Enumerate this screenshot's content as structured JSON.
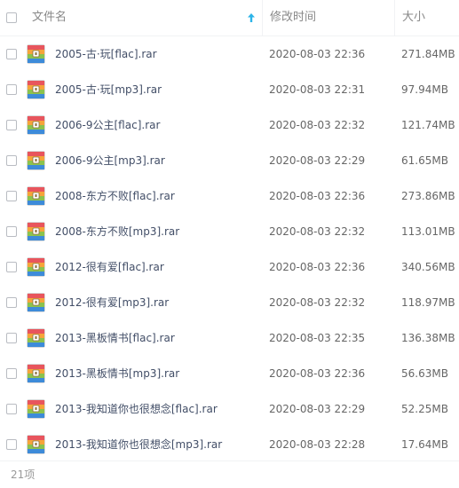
{
  "header": {
    "name_label": "文件名",
    "time_label": "修改时间",
    "size_label": "大小",
    "sort_direction": "ascending"
  },
  "colors": {
    "sort_arrow": "#2cb4e8",
    "icon_red": "#e8555d",
    "icon_orange": "#f6a43a",
    "icon_green": "#8cc34d",
    "icon_blue": "#3d8bd9"
  },
  "files": [
    {
      "name": "2005-古·玩[flac].rar",
      "time": "2020-08-03 22:36",
      "size": "271.84MB",
      "icon": "archive-rar-icon"
    },
    {
      "name": "2005-古·玩[mp3].rar",
      "time": "2020-08-03 22:31",
      "size": "97.94MB",
      "icon": "archive-rar-icon"
    },
    {
      "name": "2006-9公主[flac].rar",
      "time": "2020-08-03 22:32",
      "size": "121.74MB",
      "icon": "archive-rar-icon"
    },
    {
      "name": "2006-9公主[mp3].rar",
      "time": "2020-08-03 22:29",
      "size": "61.65MB",
      "icon": "archive-rar-icon"
    },
    {
      "name": "2008-东方不败[flac].rar",
      "time": "2020-08-03 22:36",
      "size": "273.86MB",
      "icon": "archive-rar-icon"
    },
    {
      "name": "2008-东方不败[mp3].rar",
      "time": "2020-08-03 22:32",
      "size": "113.01MB",
      "icon": "archive-rar-icon"
    },
    {
      "name": "2012-很有爱[flac].rar",
      "time": "2020-08-03 22:36",
      "size": "340.56MB",
      "icon": "archive-rar-icon"
    },
    {
      "name": "2012-很有爱[mp3].rar",
      "time": "2020-08-03 22:32",
      "size": "118.97MB",
      "icon": "archive-rar-icon"
    },
    {
      "name": "2013-黑板情书[flac].rar",
      "time": "2020-08-03 22:35",
      "size": "136.38MB",
      "icon": "archive-rar-icon"
    },
    {
      "name": "2013-黑板情书[mp3].rar",
      "time": "2020-08-03 22:36",
      "size": "56.63MB",
      "icon": "archive-rar-icon"
    },
    {
      "name": "2013-我知道你也很想念[flac].rar",
      "time": "2020-08-03 22:29",
      "size": "52.25MB",
      "icon": "archive-rar-icon"
    },
    {
      "name": "2013-我知道你也很想念[mp3].rar",
      "time": "2020-08-03 22:28",
      "size": "17.64MB",
      "icon": "archive-rar-icon"
    }
  ],
  "footer": {
    "count_label": "21项"
  }
}
